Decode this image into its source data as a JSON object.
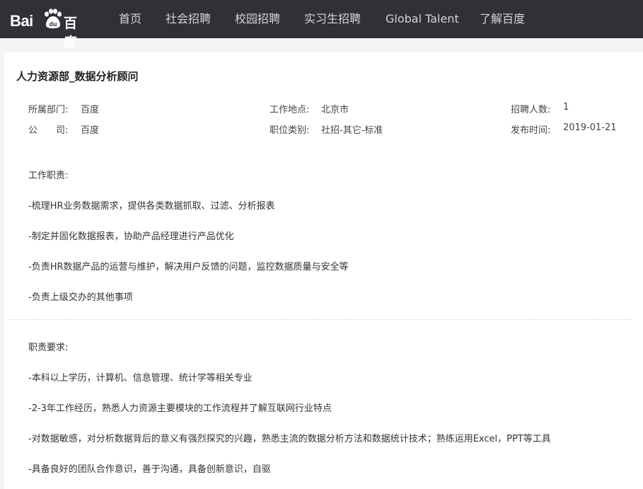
{
  "header": {
    "logo_left": "Bai",
    "logo_mid": "du",
    "logo_right": "百度",
    "nav": [
      "首页",
      "社会招聘",
      "校园招聘",
      "实习生招聘",
      "Global Talent",
      "了解百度"
    ]
  },
  "job": {
    "title": "人力资源部_数据分析顾问",
    "meta": {
      "department_label": "所属部门:",
      "department_value": "百度",
      "location_label": "工作地点:",
      "location_value": "北京市",
      "headcount_label": "招聘人数:",
      "headcount_value": "1",
      "company_label": "公　　司:",
      "company_value": "百度",
      "category_label": "职位类别:",
      "category_value": "社招-其它-标准",
      "publish_label": "发布时间:",
      "publish_value": "2019-01-21"
    },
    "duties_title": "工作职责:",
    "duties": [
      "-梳理HR业务数据需求，提供各类数据抓取、过滤、分析报表",
      "-制定并固化数据报表，协助产品经理进行产品优化",
      "-负责HR数据产品的运营与维护，解决用户反馈的问题，监控数据质量与安全等",
      "-负责上级交办的其他事项"
    ],
    "requirements_title": "职责要求:",
    "requirements": [
      "-本科以上学历，计算机、信息管理、统计学等相关专业",
      "-2-3年工作经历，熟悉人力资源主要模块的工作流程并了解互联网行业特点",
      "-对数据敏感，对分析数据背后的意义有强烈探究的兴趣，熟悉主流的数据分析方法和数据统计技术；熟练运用Excel，PPT等工具",
      "-具备良好的团队合作意识，善于沟通，具备创新意识，自驱"
    ]
  }
}
